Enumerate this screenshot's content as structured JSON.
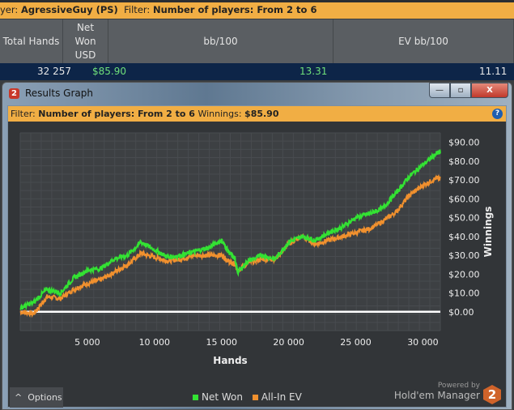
{
  "filterbar": {
    "player_label": "yer:",
    "player": "AgressiveGuy (PS)",
    "filter_label": "Filter:",
    "filter": "Number of players: From 2 to 6"
  },
  "table": {
    "headers": [
      "Total Hands",
      "Net Won USD",
      "bb/100",
      "EV bb/100"
    ],
    "row": {
      "total_hands": "32 257",
      "net_won": "$85.90",
      "bb100": "13.31",
      "ev_bb100": "11.11"
    }
  },
  "window": {
    "title": "Results Graph",
    "icon": "2",
    "buttons": {
      "minimize": "—",
      "maximize": "▫",
      "close": "X"
    }
  },
  "graph_filter": {
    "filter_label": "Filter:",
    "filter": "Number of players: From 2 to 6",
    "winnings_label": "Winnings:",
    "winnings": "$85.90",
    "help": "?"
  },
  "footer": {
    "options": "Options",
    "options_icon": "^",
    "legend": [
      "Net Won",
      "All-In EV"
    ],
    "powered_by": "Powered by",
    "brand": "Hold'em Manager",
    "brand_logo": "2"
  },
  "colors": {
    "net_won": "#33e233",
    "all_in_ev": "#f0902e"
  },
  "chart_data": {
    "type": "line",
    "xlabel": "Hands",
    "ylabel": "Winnings",
    "xlim": [
      0,
      31300
    ],
    "ylim": [
      -10,
      95
    ],
    "xticks": [
      5000,
      10000,
      15000,
      20000,
      25000,
      30000
    ],
    "xtick_labels": [
      "5 000",
      "10 000",
      "15 000",
      "20 000",
      "25 000",
      "30 000"
    ],
    "yticks": [
      0,
      10,
      20,
      30,
      40,
      50,
      60,
      70,
      80,
      90
    ],
    "ytick_labels": [
      "$0.00",
      "$10.00",
      "$20.00",
      "$30.00",
      "$40.00",
      "$50.00",
      "$60.00",
      "$70.00",
      "$80.00",
      "$90.00"
    ],
    "x": [
      0,
      1000,
      2000,
      3000,
      4000,
      5000,
      6000,
      7000,
      8000,
      9000,
      10000,
      11000,
      12000,
      13000,
      14000,
      15000,
      15500,
      16000,
      16200,
      17000,
      18000,
      19000,
      20000,
      21000,
      22000,
      23000,
      24000,
      25000,
      26000,
      27000,
      28000,
      29000,
      30000,
      31000,
      31300
    ],
    "series": [
      {
        "name": "Net Won",
        "values": [
          2,
          5,
          12,
          10,
          18,
          22,
          23,
          28,
          30,
          37,
          33,
          29,
          30,
          32,
          34,
          38,
          32,
          28,
          21,
          27,
          30,
          28,
          37,
          40,
          38,
          42,
          45,
          50,
          52,
          55,
          63,
          72,
          78,
          84,
          85
        ]
      },
      {
        "name": "All-In EV",
        "values": [
          0,
          -1,
          8,
          7,
          12,
          15,
          17,
          21,
          25,
          31,
          29,
          27,
          28,
          30,
          30,
          30,
          27,
          25,
          22,
          26,
          28,
          28,
          36,
          40,
          36,
          38,
          40,
          42,
          44,
          48,
          53,
          62,
          67,
          71,
          71
        ]
      }
    ]
  }
}
